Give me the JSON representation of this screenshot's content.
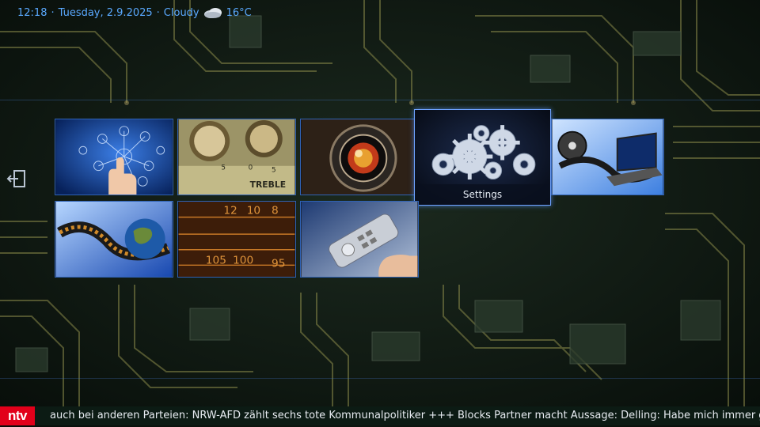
{
  "status": {
    "time": "12:18",
    "date": "Tuesday, 2.9.2025",
    "condition": "Cloudy",
    "temperature": "16°C",
    "weather_icon": "cloudy-icon"
  },
  "menu": {
    "tiles": [
      {
        "id": "network",
        "icon": "network-touch-icon",
        "label": ""
      },
      {
        "id": "audio",
        "icon": "audio-knobs-icon",
        "label": "",
        "knob_text": "TREBLE"
      },
      {
        "id": "camera",
        "icon": "camera-lens-icon",
        "label": ""
      },
      {
        "id": "settings",
        "icon": "gears-icon",
        "label": "Settings",
        "focused": true
      },
      {
        "id": "video",
        "icon": "film-laptop-icon",
        "label": ""
      },
      {
        "id": "globe-film",
        "icon": "globe-film-icon",
        "label": ""
      },
      {
        "id": "radio",
        "icon": "radio-dial-icon",
        "label": ""
      },
      {
        "id": "remote",
        "icon": "remote-control-icon",
        "label": ""
      }
    ]
  },
  "ticker": {
    "channel_logo": "ntv",
    "text": "auch bei anderen Parteien: NRW-AFD zählt sechs tote Kommunalpolitiker +++ Blocks Partner macht Aussage: Delling: Habe mich immer g"
  },
  "colors": {
    "accent": "#5aa9ff",
    "tile_border": "#2f62b5",
    "ntv_red": "#e2001a"
  }
}
